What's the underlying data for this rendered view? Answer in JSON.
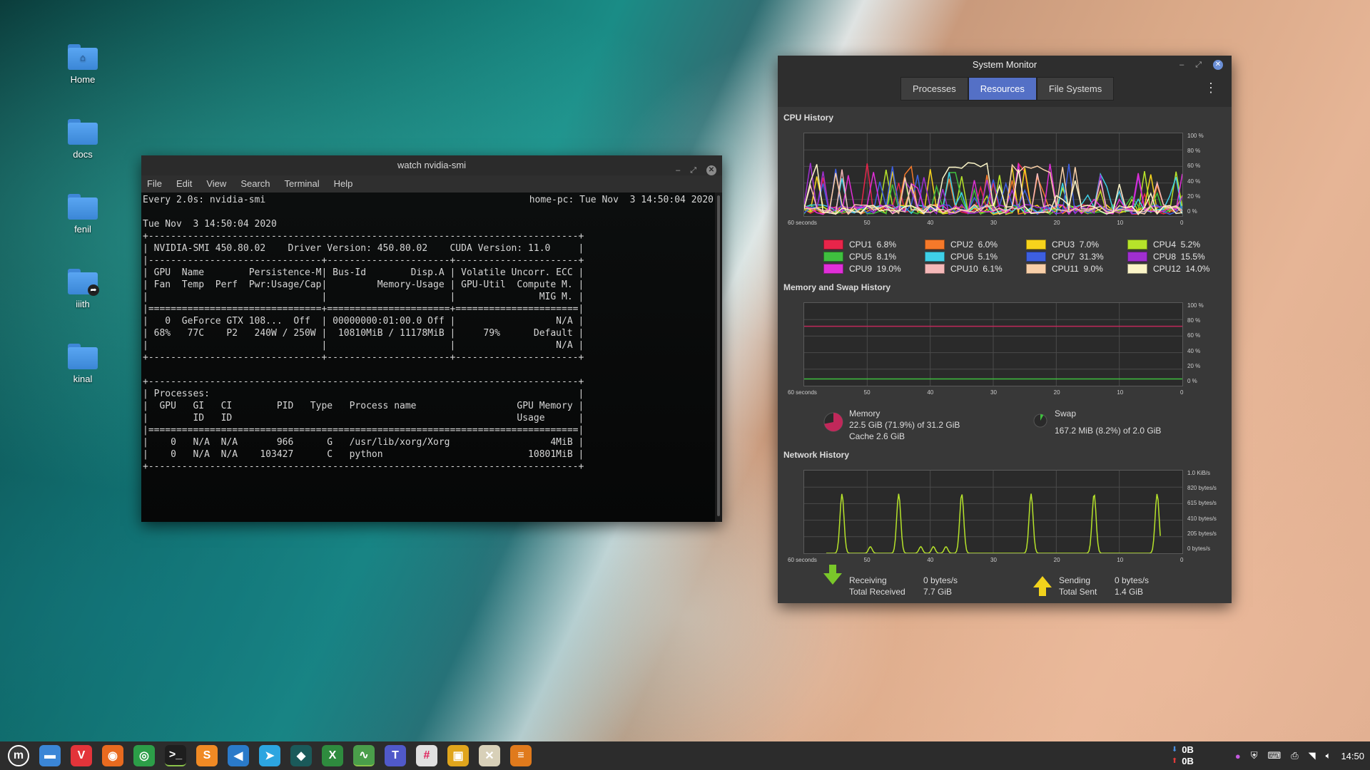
{
  "desktop": {
    "icons": [
      {
        "label": "Home"
      },
      {
        "label": "docs"
      },
      {
        "label": "fenil"
      },
      {
        "label": "iiith"
      },
      {
        "label": "kinal"
      }
    ]
  },
  "terminal": {
    "title": "watch nvidia-smi",
    "menu": [
      "File",
      "Edit",
      "View",
      "Search",
      "Terminal",
      "Help"
    ],
    "header_left": "Every 2.0s: nvidia-smi",
    "header_right": "home-pc: Tue Nov  3 14:50:04 2020",
    "output": "Tue Nov  3 14:50:04 2020\n+-----------------------------------------------------------------------------+\n| NVIDIA-SMI 450.80.02    Driver Version: 450.80.02    CUDA Version: 11.0     |\n|-------------------------------+----------------------+----------------------+\n| GPU  Name        Persistence-M| Bus-Id        Disp.A | Volatile Uncorr. ECC |\n| Fan  Temp  Perf  Pwr:Usage/Cap|         Memory-Usage | GPU-Util  Compute M. |\n|                               |                      |               MIG M. |\n|===============================+======================+======================|\n|   0  GeForce GTX 108...  Off  | 00000000:01:00.0 Off |                  N/A |\n| 68%   77C    P2   240W / 250W |  10810MiB / 11178MiB |     79%      Default |\n|                               |                      |                  N/A |\n+-------------------------------+----------------------+----------------------+\n\n+-----------------------------------------------------------------------------+\n| Processes:                                                                  |\n|  GPU   GI   CI        PID   Type   Process name                  GPU Memory |\n|        ID   ID                                                   Usage      |\n|=============================================================================|\n|    0   N/A  N/A       966      G   /usr/lib/xorg/Xorg                  4MiB |\n|    0   N/A  N/A    103427      C   python                          10801MiB |\n+-----------------------------------------------------------------------------+"
  },
  "sysmon": {
    "title": "System Monitor",
    "tabs": [
      "Processes",
      "Resources",
      "File Systems"
    ],
    "active_tab": "Resources",
    "cpu_title": "CPU History",
    "mem_title": "Memory and Swap History",
    "net_title": "Network History",
    "y_percent_ticks": [
      "100 %",
      "80 %",
      "60 %",
      "40 %",
      "20 %",
      "0 %"
    ],
    "x_ticks": [
      "60 seconds",
      "50",
      "40",
      "30",
      "20",
      "10",
      "0"
    ],
    "net_y_ticks": [
      "1.0 KiB/s",
      "820 bytes/s",
      "615 bytes/s",
      "410 bytes/s",
      "205 bytes/s",
      "0 bytes/s"
    ],
    "cpus": [
      {
        "label": "CPU1",
        "value": "6.8%",
        "color": "#e8254a"
      },
      {
        "label": "CPU2",
        "value": "6.0%",
        "color": "#f5792a"
      },
      {
        "label": "CPU3",
        "value": "7.0%",
        "color": "#f6d31c"
      },
      {
        "label": "CPU4",
        "value": "5.2%",
        "color": "#b6e32a"
      },
      {
        "label": "CPU5",
        "value": "8.1%",
        "color": "#3fbf3f"
      },
      {
        "label": "CPU6",
        "value": "5.1%",
        "color": "#3fd0e8"
      },
      {
        "label": "CPU7",
        "value": "31.3%",
        "color": "#3d5fe0"
      },
      {
        "label": "CPU8",
        "value": "15.5%",
        "color": "#a02fd0"
      },
      {
        "label": "CPU9",
        "value": "19.0%",
        "color": "#e02fd8"
      },
      {
        "label": "CPU10",
        "value": "6.1%",
        "color": "#f5b8b8"
      },
      {
        "label": "CPU11",
        "value": "9.0%",
        "color": "#f8cfa8"
      },
      {
        "label": "CPU12",
        "value": "14.0%",
        "color": "#fbf5c8"
      }
    ],
    "memory": {
      "label": "Memory",
      "used": "22.5 GiB (71.9%) of 31.2 GiB",
      "cache": "Cache 2.6 GiB",
      "percent": 71.9,
      "color": "#c0285a"
    },
    "swap": {
      "label": "Swap",
      "used": "167.2 MiB (8.2%) of 2.0 GiB",
      "percent": 8.2,
      "color": "#3fbf3f"
    },
    "network": {
      "receiving_label": "Receiving",
      "receiving_value": "0 bytes/s",
      "total_received_label": "Total Received",
      "total_received_value": "7.7 GiB",
      "sending_label": "Sending",
      "sending_value": "0 bytes/s",
      "total_sent_label": "Total Sent",
      "total_sent_value": "1.4 GiB",
      "line_color": "#b6e32a"
    }
  },
  "taskbar": {
    "apps": [
      {
        "name": "mint-menu-icon",
        "glyph": "m",
        "color": "#3a3a3a"
      },
      {
        "name": "files-icon",
        "glyph": "▬",
        "color": "#3b86d6"
      },
      {
        "name": "vivaldi-icon",
        "glyph": "V",
        "color": "#e3343a"
      },
      {
        "name": "firefox-icon",
        "glyph": "◉",
        "color": "#e86a1f"
      },
      {
        "name": "chrome-icon",
        "glyph": "◎",
        "color": "#2c9e48"
      },
      {
        "name": "terminal-icon",
        "glyph": ">_",
        "color": "#1e1e1e"
      },
      {
        "name": "sublime-icon",
        "glyph": "S",
        "color": "#f08a24"
      },
      {
        "name": "vscode-icon",
        "glyph": "◀",
        "color": "#2a7ac9"
      },
      {
        "name": "telegram-icon",
        "glyph": "➤",
        "color": "#2ca5e0"
      },
      {
        "name": "gitkraken-icon",
        "glyph": "◆",
        "color": "#1a5a5a"
      },
      {
        "name": "spreadsheet-icon",
        "glyph": "X",
        "color": "#2e8b3e"
      },
      {
        "name": "system-monitor-icon",
        "glyph": "∿",
        "color": "#4a9e4a"
      },
      {
        "name": "teams-icon",
        "glyph": "T",
        "color": "#5059c9"
      },
      {
        "name": "slack-icon",
        "glyph": "#",
        "color": "#e0e0e0"
      },
      {
        "name": "window-icon",
        "glyph": "▣",
        "color": "#e0a51c"
      },
      {
        "name": "x-app-icon",
        "glyph": "✕",
        "color": "#d8d0b8"
      },
      {
        "name": "layers-icon",
        "glyph": "≡",
        "color": "#e07a1c"
      }
    ],
    "net_down": "0B",
    "net_up": "0B",
    "clock": "14:50"
  }
}
